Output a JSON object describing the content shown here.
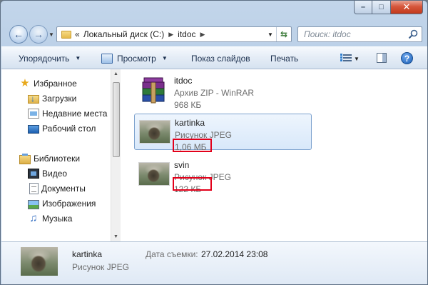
{
  "window": {
    "minimize_label": "–",
    "maximize_label": "□",
    "close_label": "✕"
  },
  "address": {
    "overflow": "«",
    "crumbs": [
      "Локальный диск (C:)",
      "itdoc"
    ]
  },
  "search": {
    "placeholder": "Поиск: itdoc"
  },
  "toolbar": {
    "organize_label": "Упорядочить",
    "view_label": "Просмотр",
    "slideshow_label": "Показ слайдов",
    "print_label": "Печать",
    "help_label": "?"
  },
  "sidebar": {
    "favorites": {
      "label": "Избранное",
      "items": [
        {
          "label": "Загрузки",
          "icon": "downloads-icon"
        },
        {
          "label": "Недавние места",
          "icon": "recent-places-icon"
        },
        {
          "label": "Рабочий стол",
          "icon": "desktop-icon"
        }
      ]
    },
    "libraries": {
      "label": "Библиотеки",
      "items": [
        {
          "label": "Видео",
          "icon": "video-icon"
        },
        {
          "label": "Документы",
          "icon": "documents-icon"
        },
        {
          "label": "Изображения",
          "icon": "images-icon"
        },
        {
          "label": "Музыка",
          "icon": "music-icon"
        }
      ]
    }
  },
  "files": [
    {
      "name": "itdoc",
      "type": "Архив ZIP - WinRAR",
      "size": "968 КБ",
      "icon": "winrar-archive-icon",
      "selected": false
    },
    {
      "name": "kartinka",
      "type": "Рисунок JPEG",
      "size": "1,06 МБ",
      "icon": "jpeg-thumbnail",
      "selected": true
    },
    {
      "name": "svin",
      "type": "Рисунок JPEG",
      "size": "122 КБ",
      "icon": "jpeg-thumbnail",
      "selected": false
    }
  ],
  "details": {
    "name": "kartinka",
    "type": "Рисунок JPEG",
    "date_label": "Дата съемки:",
    "date_value": "27.02.2014 23:08"
  },
  "colors": {
    "selection_border": "#7da2ce",
    "highlight_box": "#e2001a",
    "toolbar_text": "#1e3250"
  }
}
